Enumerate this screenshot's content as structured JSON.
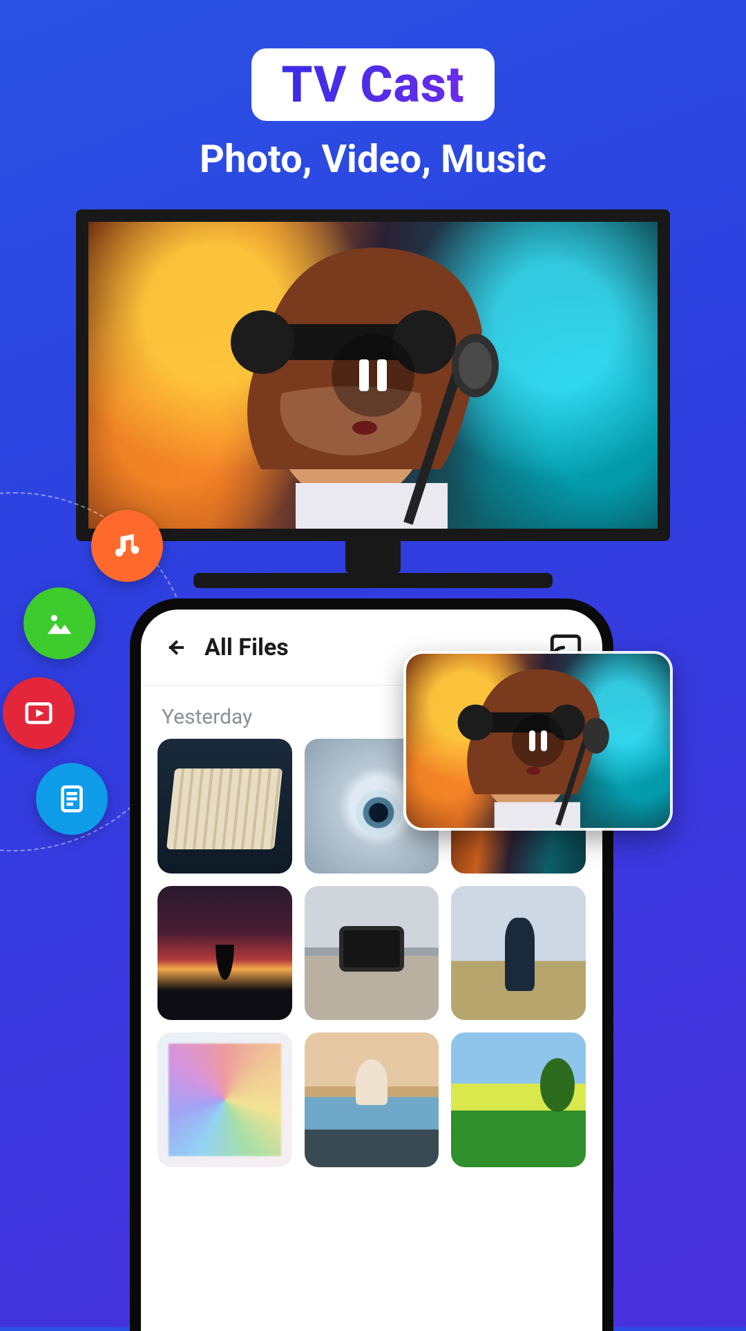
{
  "header": {
    "badge": "TV Cast",
    "subtitle": "Photo, Video, Music"
  },
  "tv": {
    "state_icon": "pause"
  },
  "orbit": {
    "chips": [
      "music",
      "photo",
      "video",
      "document"
    ]
  },
  "phone": {
    "top": {
      "back_icon": "back",
      "title": "All Files",
      "action_icon": "cast"
    },
    "sections": [
      {
        "label": "Yesterday",
        "tile_count": 9
      }
    ]
  },
  "preview": {
    "state_icon": "pause"
  }
}
